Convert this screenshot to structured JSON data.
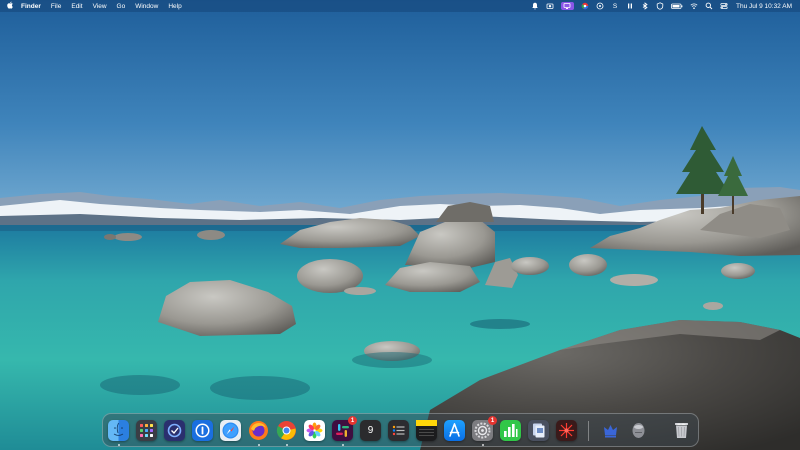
{
  "menubar": {
    "apple_icon": "apple-icon",
    "app_name": "Finder",
    "items": [
      "File",
      "Edit",
      "View",
      "Go",
      "Window",
      "Help"
    ],
    "status_icons": [
      "bell-icon",
      "screenshot-icon",
      "display-icon",
      "chrome-extension-icon",
      "network-icon",
      "s-icon",
      "pause-icon",
      "bluetooth-icon",
      "vpn-icon",
      "battery-icon",
      "wifi-icon",
      "search-icon",
      "control-center-icon"
    ],
    "clock": "Thu Jul 9  10:32 AM"
  },
  "dock": {
    "apps": [
      {
        "name": "Finder",
        "icon": "finder-icon",
        "running": true
      },
      {
        "name": "Launchpad",
        "icon": "launchpad-icon",
        "running": false
      },
      {
        "name": "OmniFocus",
        "icon": "omnifocus-icon",
        "running": false
      },
      {
        "name": "1Password",
        "icon": "onepassword-icon",
        "running": false
      },
      {
        "name": "Safari",
        "icon": "safari-icon",
        "running": false
      },
      {
        "name": "Firefox",
        "icon": "firefox-icon",
        "running": true
      },
      {
        "name": "Chrome",
        "icon": "chrome-icon",
        "running": true
      },
      {
        "name": "Photos",
        "icon": "photos-icon",
        "running": false
      },
      {
        "name": "Slack",
        "icon": "slack-icon",
        "running": true,
        "badge": "1"
      },
      {
        "name": "Calendar",
        "icon": "calendar-icon",
        "running": false,
        "label": "9"
      },
      {
        "name": "Reminders",
        "icon": "reminders-icon",
        "running": false
      },
      {
        "name": "Notes",
        "icon": "notes-icon",
        "running": false
      },
      {
        "name": "App Store",
        "icon": "app-store-icon",
        "running": false
      },
      {
        "name": "System Preferences",
        "icon": "system-preferences-icon",
        "running": true,
        "badge": "1"
      },
      {
        "name": "Numbers",
        "icon": "numbers-icon",
        "running": false
      },
      {
        "name": "Preview",
        "icon": "preview-icon",
        "running": false
      },
      {
        "name": "Radar",
        "icon": "radar-icon",
        "running": false
      },
      {
        "name": "Utility",
        "icon": "crown-icon",
        "running": false
      },
      {
        "name": "Disk",
        "icon": "disk-icon",
        "running": false
      },
      {
        "name": "Trash",
        "icon": "trash-icon",
        "running": false
      }
    ]
  }
}
